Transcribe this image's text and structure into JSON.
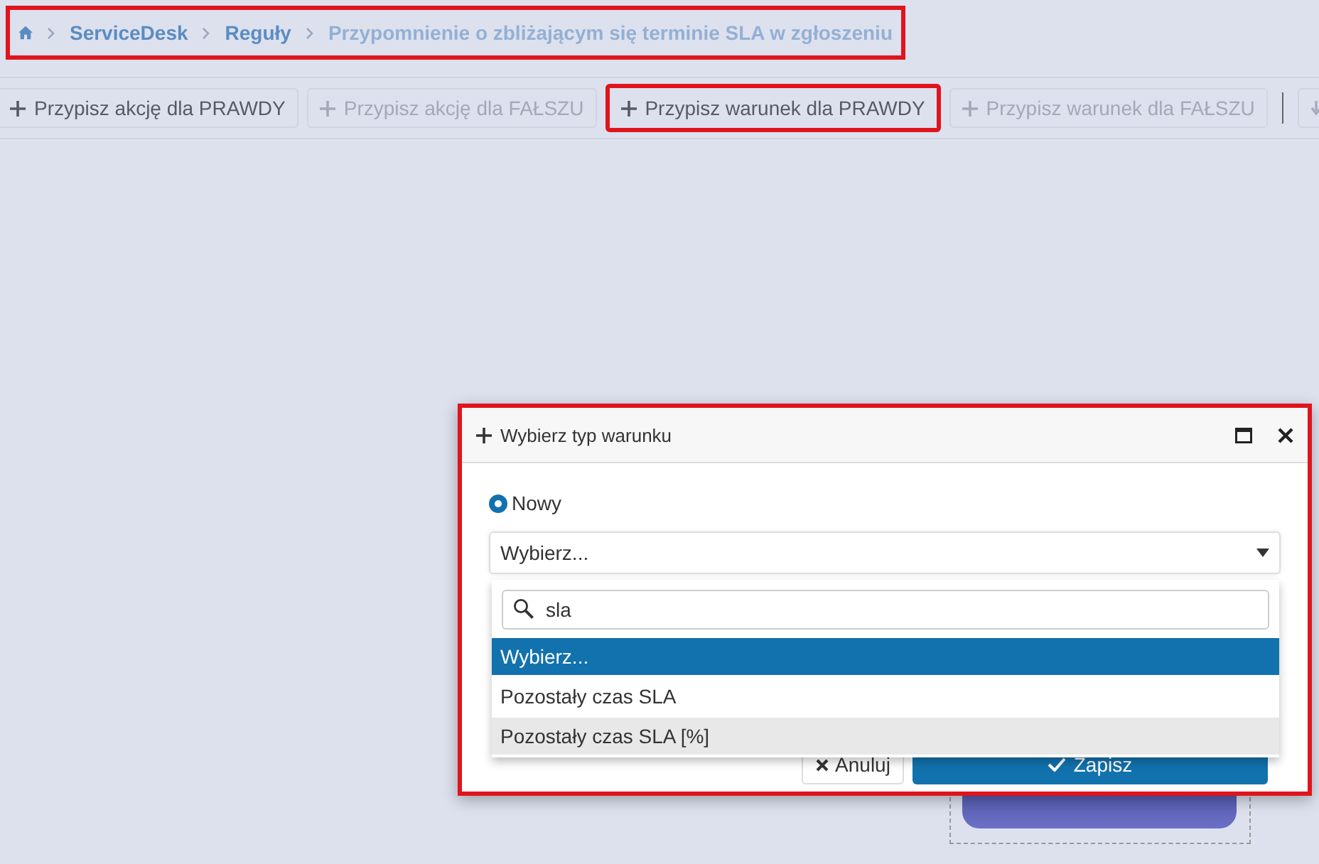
{
  "breadcrumb": {
    "highlighted": true,
    "items": [
      {
        "label": "ServiceDesk",
        "current": false
      },
      {
        "label": "Reguły",
        "current": false
      },
      {
        "label": "Przypomnienie o zbliżającym się terminie SLA w zgłoszeniu",
        "current": true
      }
    ]
  },
  "toolbar": [
    {
      "kind": "add",
      "label": "Przypisz akcję dla PRAWDY",
      "disabled": false,
      "highlighted": false
    },
    {
      "kind": "add",
      "label": "Przypisz akcję dla FAŁSZU",
      "disabled": true,
      "highlighted": false
    },
    {
      "kind": "add",
      "label": "Przypisz warunek dla PRAWDY",
      "disabled": false,
      "highlighted": true
    },
    {
      "kind": "add",
      "label": "Przypisz warunek dla FAŁSZU",
      "disabled": true,
      "highlighted": false
    },
    {
      "kind": "separator"
    },
    {
      "kind": "down",
      "disabled": true,
      "highlighted": false
    }
  ],
  "dialog": {
    "title": "Wybierz typ warunku",
    "highlighted": true,
    "radio": {
      "label": "Nowy",
      "selected": true
    },
    "select": {
      "value": "Wybierz...",
      "expanded": true,
      "search": "sla",
      "options": [
        {
          "label": "Wybierz...",
          "selected": true,
          "hovered": false
        },
        {
          "label": "Pozostały czas SLA",
          "selected": false,
          "hovered": false
        },
        {
          "label": "Pozostały czas SLA [%]",
          "selected": false,
          "hovered": true
        }
      ]
    },
    "buttons": [
      {
        "kind": "cancel",
        "label": "Anuluj"
      },
      {
        "kind": "save",
        "label": "Zapisz"
      }
    ]
  }
}
